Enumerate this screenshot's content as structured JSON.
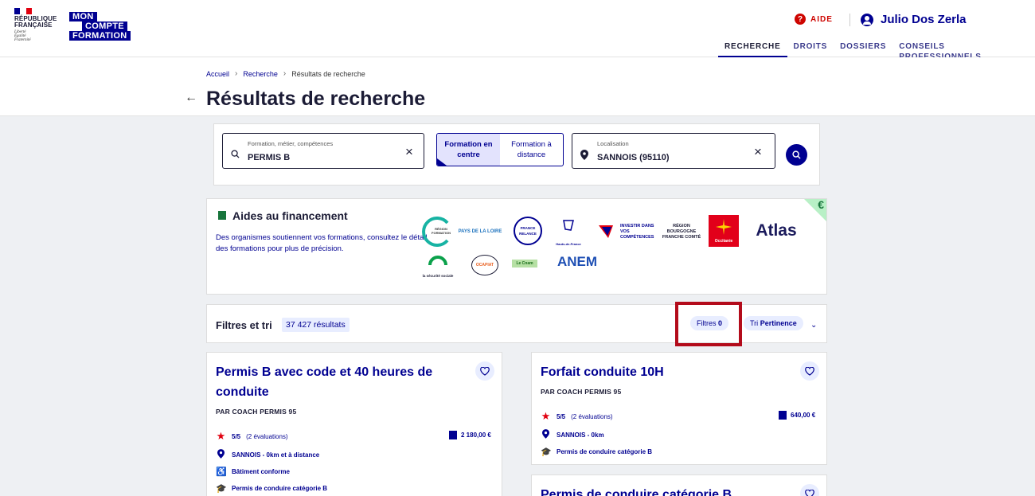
{
  "header": {
    "rf_logo_text": "RÉPUBLIQUE\nFRANÇAISE",
    "rf_motto": "Liberté\nÉgalité\nFraternité",
    "mcf_logo": [
      "MON",
      "COMPTE",
      "FORMATION"
    ],
    "help_label": "AIDE",
    "user_name": "Julio Dos Zerla",
    "nav": [
      "RECHERCHE",
      "DROITS",
      "DOSSIERS",
      "CONSEILS PROFESSIONNELS"
    ],
    "nav_active": "RECHERCHE"
  },
  "breadcrumb": [
    "Accueil",
    "Recherche",
    "Résultats de recherche"
  ],
  "page_title": "Résultats de recherche",
  "search": {
    "query_label": "Formation, métier, compétences",
    "query_value": "PERMIS B",
    "toggle_options": [
      "Formation en centre",
      "Formation à distance"
    ],
    "toggle_selected": "Formation en centre",
    "location_label": "Localisation",
    "location_value": "SANNOIS (95110)"
  },
  "financing": {
    "title": "Aides au financement",
    "description": "Des organismes soutiennent vos formations, consultez le détail des formations pour plus de précision.",
    "corner_symbol": "€",
    "partners": [
      "RÉGION FORMATION",
      "PAYS DE LA LOIRE",
      "FRANCE RELANCE",
      "Hauts-de-France",
      "INVESTIR DANS VOS COMPÉTENCES",
      "RÉGION BOURGOGNE FRANCHE COMTÉ",
      "Occitanie",
      "Atlas",
      "la sécurité sociale",
      "OCAPIAT",
      "Le Cnam",
      "ANEM"
    ]
  },
  "filters": {
    "title": "Filtres et tri",
    "results_count": "37 427 résultats",
    "filters_label": "Filtres",
    "filters_count": "0",
    "sort_label": "Tri",
    "sort_value": "Pertinence"
  },
  "results": [
    {
      "title": "Permis B avec code et 40 heures de conduite",
      "provider": "PAR COACH PERMIS 95",
      "rating": "5/5",
      "rating_count": "(2 évaluations)",
      "price": "2 180,00 €",
      "location": "SANNOIS - 0km et à distance",
      "accessibility": "Bâtiment conforme",
      "certification": "Permis de conduire catégorie B"
    },
    {
      "title": "Forfait conduite 10H",
      "provider": "PAR COACH PERMIS 95",
      "rating": "5/5",
      "rating_count": "(2 évaluations)",
      "price": "640,00 €",
      "location": "SANNOIS - 0km",
      "certification": "Permis de conduire catégorie B"
    },
    {
      "title": "Permis de conduire catégorie B"
    }
  ],
  "colors": {
    "primary": "#000091",
    "danger": "#ce0500",
    "highlight": "#b30b1b",
    "background": "#eef0f3"
  },
  "icons": [
    "help-icon",
    "user-icon",
    "search-icon",
    "close-icon",
    "location-pin-icon",
    "search-button-icon",
    "euro-icon",
    "heart-icon",
    "star-icon",
    "wallet-icon",
    "accessibility-icon",
    "graduation-cap-icon",
    "chevron-down-icon",
    "arrow-left-icon"
  ]
}
